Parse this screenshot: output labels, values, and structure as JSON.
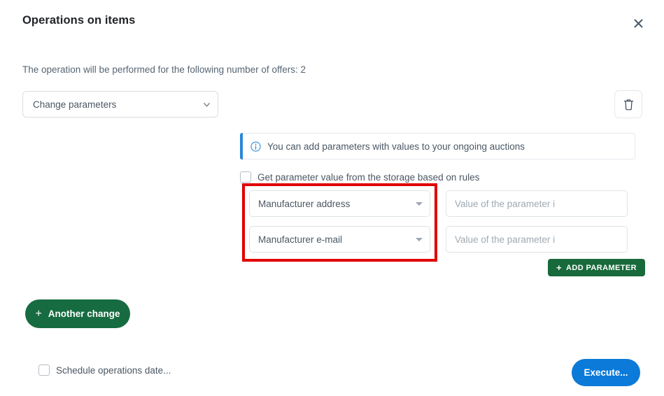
{
  "dialog": {
    "title": "Operations on items",
    "close_label": "×",
    "intro": "The operation will be performed for the following number of offers: 2"
  },
  "operation": {
    "selected": "Change parameters",
    "chevron_icon": "chevron-down-icon"
  },
  "delete_button": {
    "icon": "trash-icon",
    "label": ""
  },
  "info_banner": {
    "icon": "info-circle-icon",
    "text": "You can add parameters with values to your ongoing auctions",
    "accent_color": "#2a86d8"
  },
  "storage_checkbox": {
    "checked": false,
    "label": "Get parameter value from the storage based on rules"
  },
  "parameters": [
    {
      "name_selected": "Manufacturer address",
      "value": "",
      "value_placeholder": "Value of the parameter i"
    },
    {
      "name_selected": "Manufacturer e-mail",
      "value": "",
      "value_placeholder": "Value of the parameter i"
    }
  ],
  "add_parameter_button": {
    "plus": "+",
    "label": "ADD PARAMETER",
    "color": "#186A3B"
  },
  "another_change_button": {
    "plus": "+",
    "label": "Another change",
    "color": "#176B41"
  },
  "schedule_checkbox": {
    "checked": false,
    "label": "Schedule operations date..."
  },
  "execute_button": {
    "label": "Execute...",
    "color": "#0b7ad8"
  },
  "highlight": {
    "color": "#e00000",
    "target": "parameter-name-selects"
  }
}
